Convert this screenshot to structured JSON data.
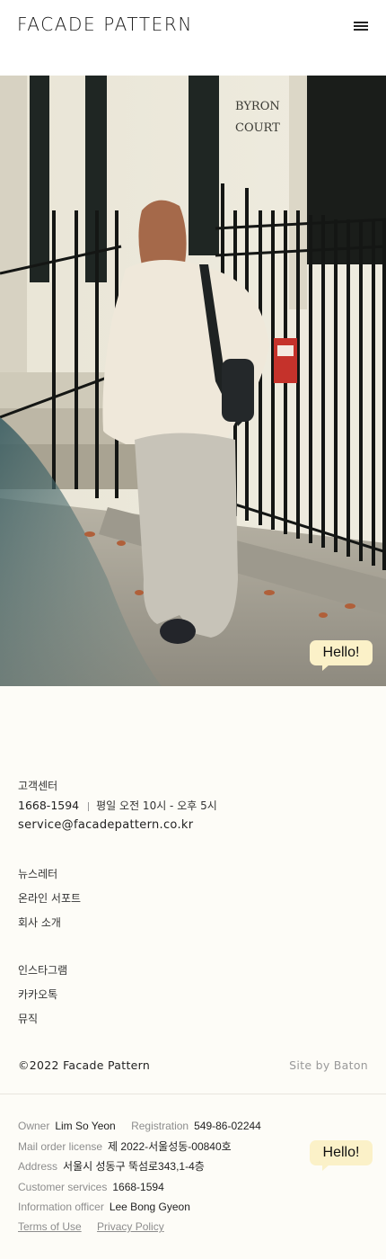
{
  "header": {
    "logo": "FACADE PATTERN",
    "menu_icon": "hamburger-icon"
  },
  "chat": {
    "label": "Hello!"
  },
  "footer": {
    "customer_center": "고객센터",
    "phone": "1668-1594",
    "hours": "평일 오전 10시 - 오후 5시",
    "email": "service@facadepattern.co.kr",
    "links_group1": [
      "뉴스레터",
      "온라인 서포트",
      "회사 소개"
    ],
    "links_group2": [
      "인스타그램",
      "카카오톡",
      "뮤직"
    ],
    "copyright": "©2022 Facade Pattern",
    "site_by": "Site by Baton"
  },
  "business": {
    "owner_label": "Owner",
    "owner": "Lim So Yeon",
    "registration_label": "Registration",
    "registration": "549-86-02244",
    "mail_order_label": "Mail order license",
    "mail_order": "제 2022-서울성동-00840호",
    "address_label": "Address",
    "address": "서울시 성동구 뚝섬로343,1-4층",
    "customer_services_label": "Customer services",
    "customer_services": "1668-1594",
    "info_officer_label": "Information officer",
    "info_officer": "Lee Bong Gyeon",
    "terms": "Terms of Use",
    "privacy": "Privacy Policy"
  },
  "colors": {
    "background": "#fdfcf7",
    "chat_bubble": "#fbf1c8",
    "muted_text": "#8d8d8d"
  }
}
